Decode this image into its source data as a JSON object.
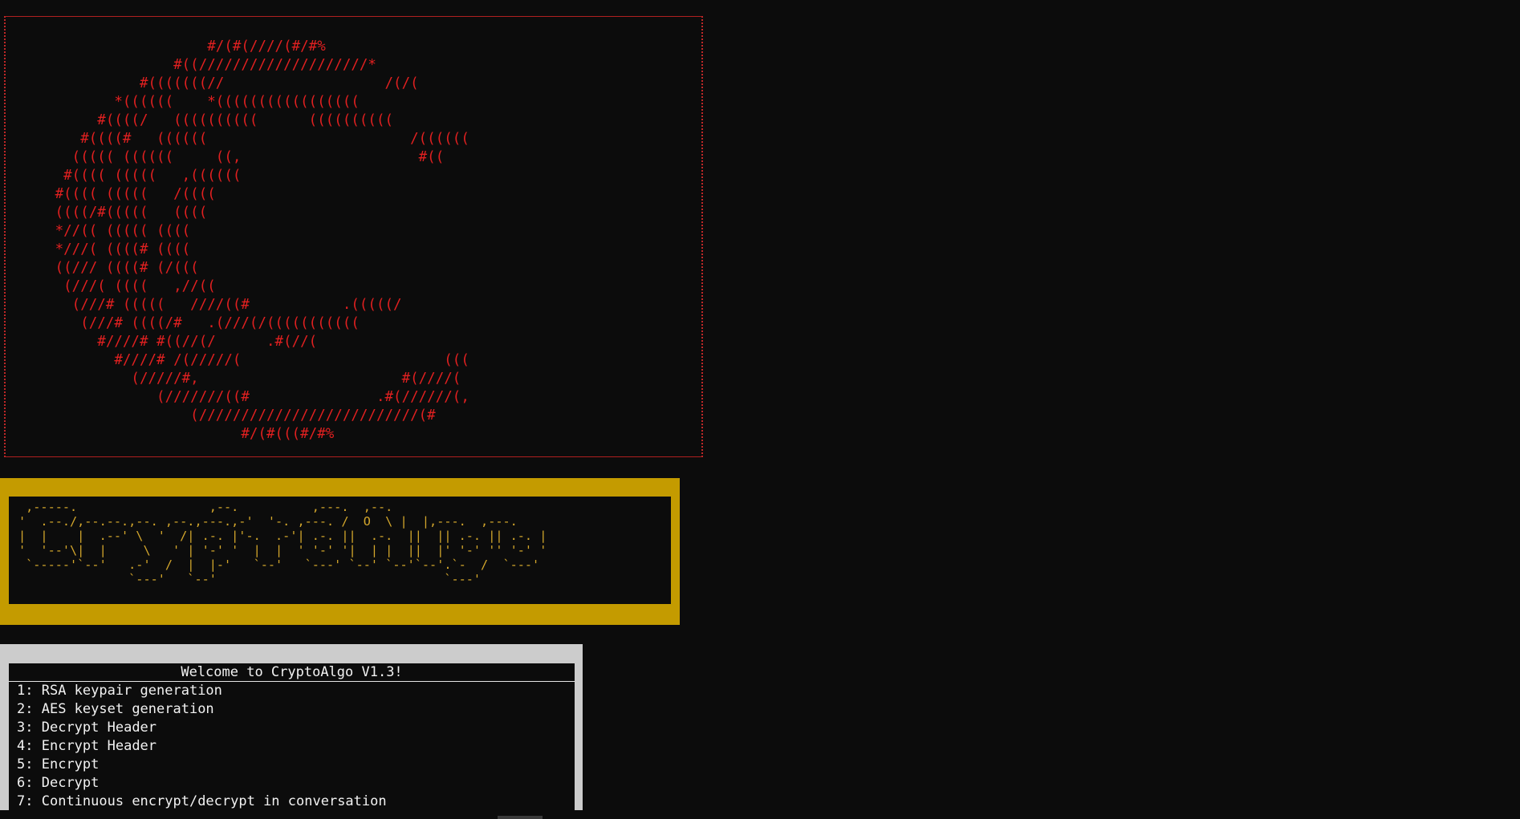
{
  "logo": {
    "ascii_art": "                     #/(#(////(#/#%\n                 #((////////////////////*\n             #(((((((//                   /(/(\n          *((((((    *(((((((((((((((((\n        #((((/   ((((((((((      ((((((((((\n      #((((#   ((((((                        /((((((\n     ((((( ((((((     ((,                     #((\n    #(((( (((((   ,((((((\n   #(((( (((((   /((((\n   ((((/#(((((   ((((\n   *//(( ((((( ((((\n   *///( ((((# ((((\n   ((/// ((((# (/(((\n    (///( ((((   ,//((\n     (///# (((((   ////((#           .(((((/\n      (///# ((((/#   .(///(/(((((((((((\n        #////# #((//(/      .#(//(\n          #////# /(/////(                        (((\n            (/////#,                        #(////(\n               (///////((#               .#(//////(,\n                   (//////////////////////////(#\n                         #/(#(((#/#%",
    "color": "#e02020"
  },
  "banner": {
    "ascii_art": " ,-----.                  ,--.          ,---.  ,--.\n'  .--./,--.--.,--. ,--.,---.,-'  '-. ,---. /  O  \\ |  |,---.  ,---.\n|  |    |  .--' \\  '  /| .-. |'-.  .-'| .-. ||  .-.  ||  || .-. || .-. |\n'  '--'\\|  |     \\   ' | '-' '  |  |  ' '-' '|  | |  ||  |' '-' '' '-' '\n `-----'`--'   .-'  /  |  |-'   `--'   `---' `--' `--'`--'.`-  /  `---'\n               `---'   `--'                               `---'",
    "color": "#d4a72c"
  },
  "menu": {
    "title": "Welcome to CryptoAlgo V1.3!",
    "separator": ": ",
    "items": [
      {
        "num": "1",
        "label": "RSA keypair generation"
      },
      {
        "num": "2",
        "label": "AES keyset generation"
      },
      {
        "num": "3",
        "label": "Decrypt Header"
      },
      {
        "num": "4",
        "label": "Encrypt Header"
      },
      {
        "num": "5",
        "label": "Encrypt"
      },
      {
        "num": "6",
        "label": "Decrypt"
      },
      {
        "num": "7",
        "label": "Continuous encrypt/decrypt in conversation"
      }
    ]
  },
  "colors": {
    "background": "#0c0c0c",
    "logo_border": "#b02020",
    "banner_frame": "#c49b00",
    "menu_frame": "#cccccc",
    "menu_text": "#f2f2f2"
  }
}
